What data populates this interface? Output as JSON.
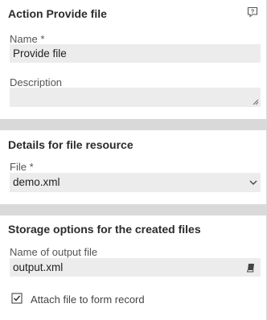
{
  "action_panel": {
    "title": "Action Provide file",
    "name_label": "Name",
    "required_mark": "*",
    "name_value": "Provide file",
    "description_label": "Description",
    "description_value": ""
  },
  "file_panel": {
    "title": "Details for file resource",
    "file_label": "File",
    "required_mark": "*",
    "file_value": "demo.xml"
  },
  "storage_panel": {
    "title": "Storage options for the created files",
    "output_label": "Name of output file",
    "output_value": "output.xml",
    "attach_label": "Attach file to form record",
    "attach_checked": true
  },
  "icons": {
    "help": "help-icon",
    "dropdown": "chevron-down-icon",
    "book": "book-icon",
    "checkbox": "checkbox-icon",
    "resize": "resize-grip-icon"
  },
  "colors": {
    "panel_bg": "#ffffff",
    "page_bg": "#d9d9d9",
    "field_bg": "#ececec"
  }
}
